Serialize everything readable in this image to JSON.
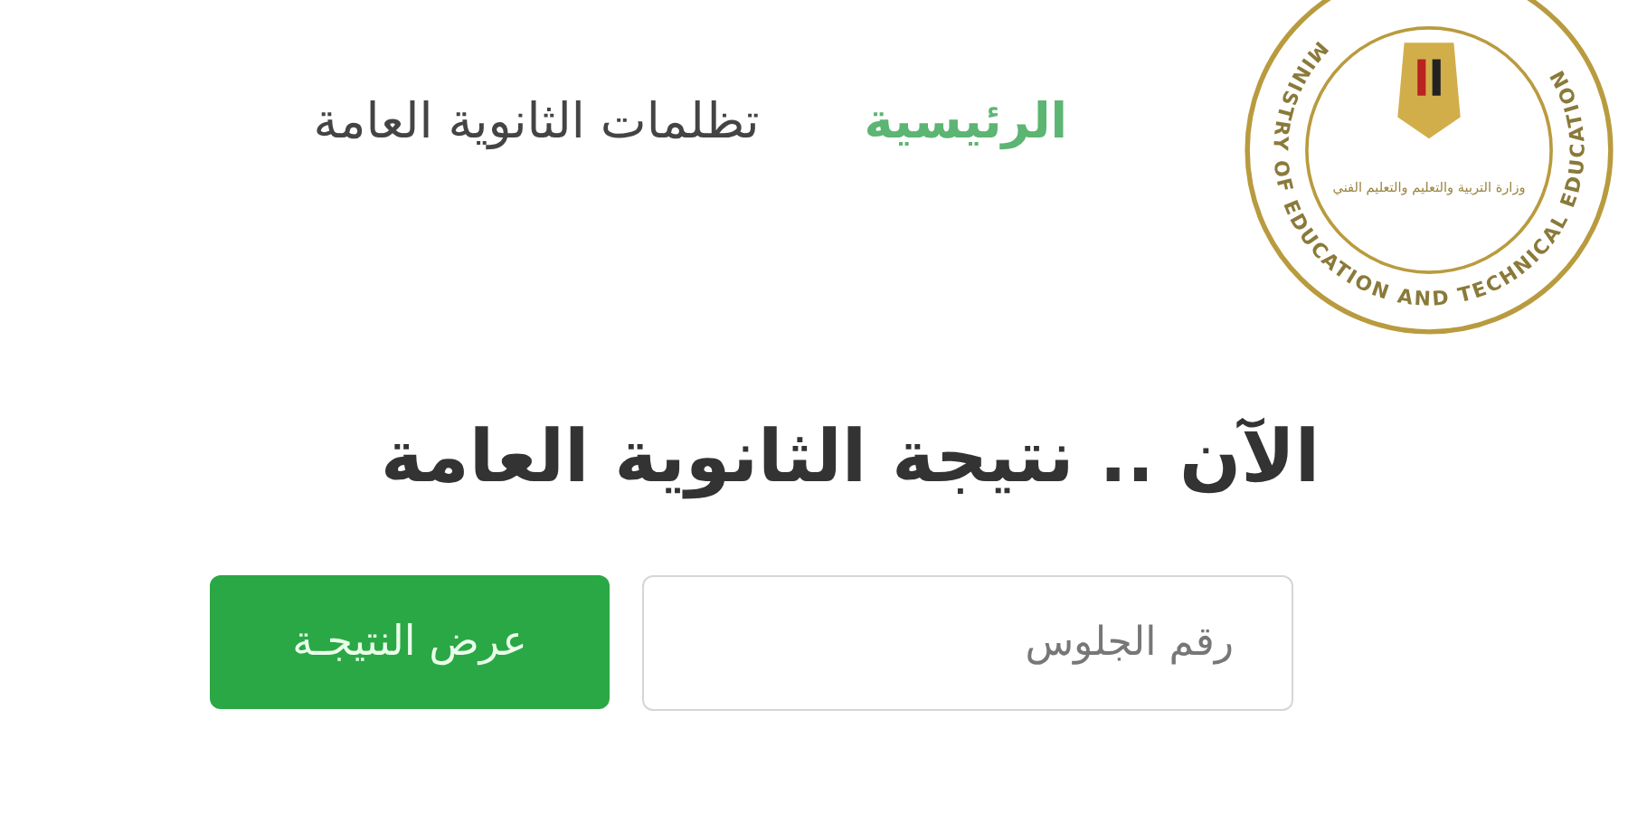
{
  "logo": {
    "ring_text": "MINISTRY OF EDUCATION AND TECHNICAL EDUCATION",
    "center_text": "وزارة التربية والتعليم والتعليم الفني"
  },
  "nav": [
    {
      "label": "الرئيسية",
      "selected": true
    },
    {
      "label": "تظلمات الثانوية العامة",
      "selected": false
    }
  ],
  "heading": "الآن .. نتيجة الثانوية العامة",
  "search": {
    "placeholder": "رقم الجلوس",
    "button": "عرض النتيجـة"
  }
}
